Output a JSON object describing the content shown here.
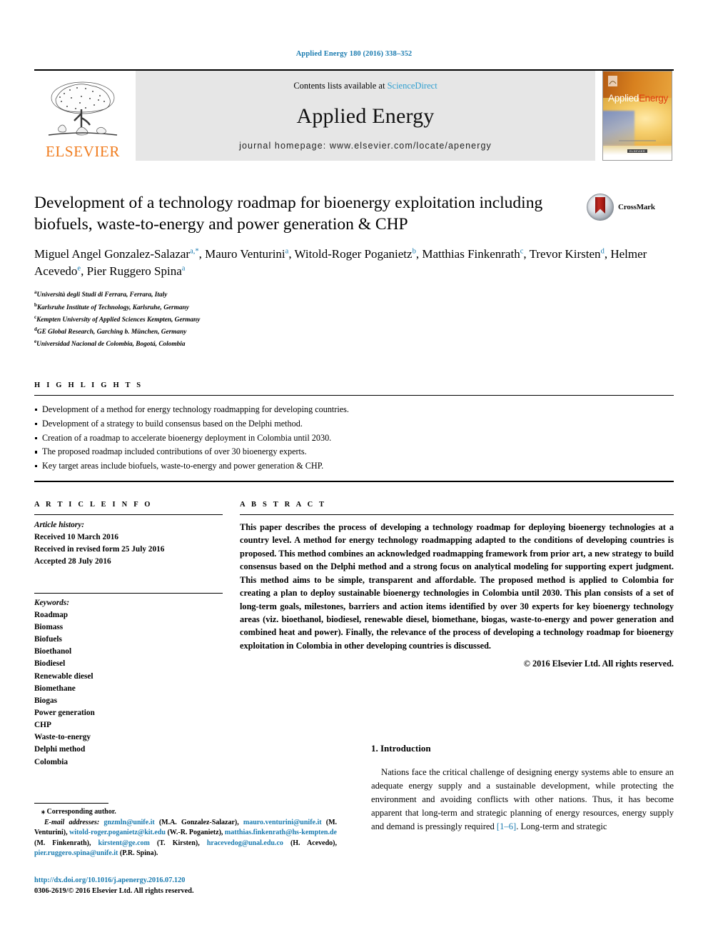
{
  "running_head": "Applied Energy 180 (2016) 338–352",
  "masthead": {
    "publisher_logo_label": "ELSEVIER",
    "contents_prefix": "Contents lists available at ",
    "contents_link": "ScienceDirect",
    "journal_title": "Applied Energy",
    "homepage": "journal homepage: www.elsevier.com/locate/apenergy",
    "cover": {
      "title_a": "Applied",
      "title_b": "Energy",
      "imprint": "ELSEVIER"
    }
  },
  "article": {
    "title": "Development of a technology roadmap for bioenergy exploitation including biofuels, waste-to-energy and power generation & CHP",
    "crossmark_label": "CrossMark",
    "authors": [
      {
        "name": "Miguel Angel Gonzalez-Salazar",
        "marks": "a,*",
        "sep": ", "
      },
      {
        "name": "Mauro Venturini",
        "marks": "a",
        "sep": ", "
      },
      {
        "name": "Witold-Roger Poganietz",
        "marks": "b",
        "sep": ", "
      },
      {
        "name": "Matthias Finkenrath",
        "marks": "c",
        "sep": ", "
      },
      {
        "name": "Trevor Kirsten",
        "marks": "d",
        "sep": ", "
      },
      {
        "name": "Helmer Acevedo",
        "marks": "e",
        "sep": ", "
      },
      {
        "name": "Pier Ruggero Spina",
        "marks": "a",
        "sep": ""
      }
    ],
    "affiliations": [
      {
        "mark": "a",
        "text": "Università degli Studi di Ferrara, Ferrara, Italy"
      },
      {
        "mark": "b",
        "text": "Karlsruhe Institute of Technology, Karlsruhe, Germany"
      },
      {
        "mark": "c",
        "text": "Kempten University of Applied Sciences Kempten, Germany"
      },
      {
        "mark": "d",
        "text": "GE Global Research, Garching b. München, Germany"
      },
      {
        "mark": "e",
        "text": "Universidad Nacional de Colombia, Bogotá, Colombia"
      }
    ]
  },
  "highlights": {
    "heading": "H I G H L I G H T S",
    "items": [
      "Development of a method for energy technology roadmapping for developing countries.",
      "Development of a strategy to build consensus based on the Delphi method.",
      "Creation of a roadmap to accelerate bioenergy deployment in Colombia until 2030.",
      "The proposed roadmap included contributions of over 30 bioenergy experts.",
      "Key target areas include biofuels, waste-to-energy and power generation & CHP."
    ]
  },
  "article_info": {
    "heading": "A R T I C L E   I N F O",
    "history_label": "Article history:",
    "history": [
      "Received 10 March 2016",
      "Received in revised form 25 July 2016",
      "Accepted 28 July 2016"
    ],
    "keywords_label": "Keywords:",
    "keywords": [
      "Roadmap",
      "Biomass",
      "Biofuels",
      "Bioethanol",
      "Biodiesel",
      "Renewable diesel",
      "Biomethane",
      "Biogas",
      "Power generation",
      "CHP",
      "Waste-to-energy",
      "Delphi method",
      "Colombia"
    ]
  },
  "abstract": {
    "heading": "A B S T R A C T",
    "text": "This paper describes the process of developing a technology roadmap for deploying bioenergy technologies at a country level. A method for energy technology roadmapping adapted to the conditions of developing countries is proposed. This method combines an acknowledged roadmapping framework from prior art, a new strategy to build consensus based on the Delphi method and a strong focus on analytical modeling for supporting expert judgment. This method aims to be simple, transparent and affordable. The proposed method is applied to Colombia for creating a plan to deploy sustainable bioenergy technologies in Colombia until 2030. This plan consists of a set of long-term goals, milestones, barriers and action items identified by over 30 experts for key bioenergy technology areas (viz. bioethanol, biodiesel, renewable diesel, biomethane, biogas, waste-to-energy and power generation and combined heat and power). Finally, the relevance of the process of developing a technology roadmap for bioenergy exploitation in Colombia in other developing countries is discussed.",
    "copyright": "© 2016 Elsevier Ltd. All rights reserved."
  },
  "introduction": {
    "heading": "1. Introduction",
    "paragraph_part1": "Nations face the critical challenge of designing energy systems able to ensure an adequate energy supply and a sustainable development, while protecting the environment and avoiding conflicts with other nations. Thus, it has become apparent that long-term and strategic planning of energy resources, energy supply and demand is pressingly required ",
    "reference": "[1–6]",
    "paragraph_part2": ". Long-term and strategic"
  },
  "footnote": {
    "corresponding": "⁎ Corresponding author.",
    "email_label": "E-mail addresses:",
    "emails": [
      {
        "address": "gnzmln@unife.it",
        "person": " (M.A. Gonzalez-Salazar), "
      },
      {
        "address": "mauro.venturini@unife.it",
        "person": " (M. Venturini), "
      },
      {
        "address": "witold-roger.poganietz@kit.edu",
        "person": " (W.-R. Poganietz), "
      },
      {
        "address": "matthias.finkenrath@hs-kempten.de",
        "person": " (M. Finkenrath), "
      },
      {
        "address": "kirstent@ge.com",
        "person": " (T. Kirsten), "
      },
      {
        "address": "hracevedog@unal.edu.co",
        "person": " (H. Acevedo), "
      },
      {
        "address": "pier.ruggero.spina@unife.it",
        "person": " (P.R. Spina)."
      }
    ],
    "doi": "http://dx.doi.org/10.1016/j.apenergy.2016.07.120",
    "issn_line": "0306-2619/© 2016 Elsevier Ltd. All rights reserved."
  },
  "colors": {
    "link_blue": "#1a7bb0",
    "sciencedirect_blue": "#2f9fd0",
    "elsevier_orange": "#f07c1e"
  }
}
